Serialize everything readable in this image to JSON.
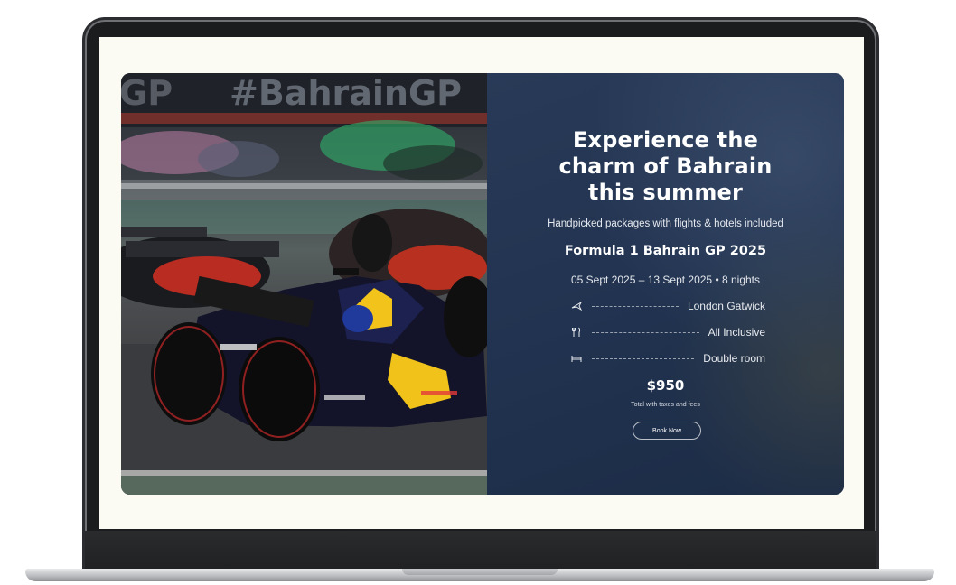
{
  "hero": {
    "banner_text": "#BahrainGP",
    "banner_left_text": "GP"
  },
  "offer": {
    "headline_line1": "Experience the",
    "headline_line2": "charm of Bahrain",
    "headline_line3": "this summer",
    "subtitle": "Handpicked packages with flights & hotels included",
    "event_name": "Formula 1 Bahrain GP 2025",
    "dates": "05 Sept 2025 – 13 Sept 2025 • 8 nights",
    "features": [
      {
        "icon": "plane-icon",
        "label": "London Gatwick"
      },
      {
        "icon": "utensils-icon",
        "label": "All Inclusive"
      },
      {
        "icon": "bed-icon",
        "label": "Double room"
      }
    ],
    "price": "$950",
    "price_note": "Total with taxes and fees",
    "book_label": "Book Now"
  },
  "colors": {
    "panel": "#213350",
    "text": "#ffffff",
    "screen_bg": "#fbfbf4"
  }
}
